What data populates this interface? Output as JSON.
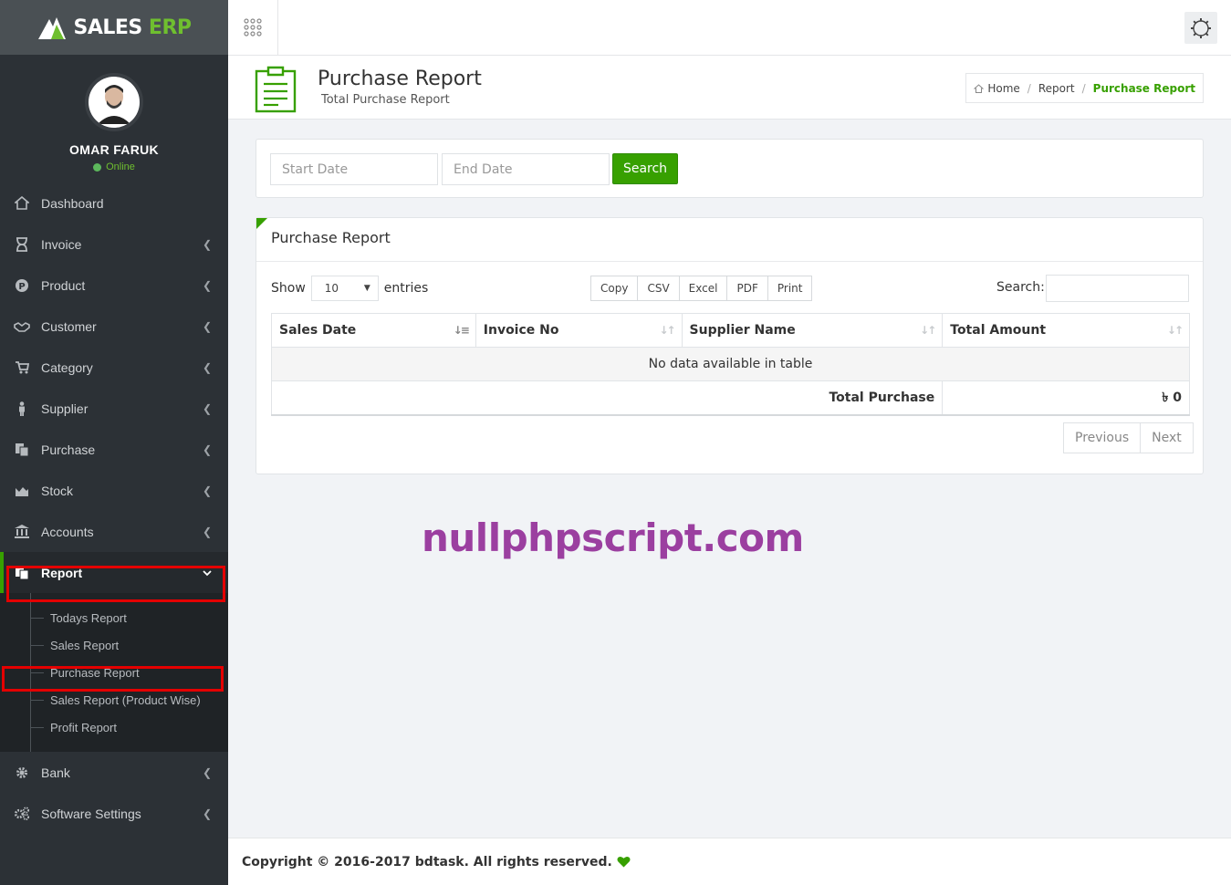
{
  "brand": {
    "name_left": "SALES",
    "name_right": "ERP"
  },
  "user": {
    "name": "OMAR FARUK",
    "status": "Online"
  },
  "sidebar": {
    "items": [
      {
        "label": "Dashboard",
        "icon": "home-icon"
      },
      {
        "label": "Invoice",
        "icon": "hourglass-icon"
      },
      {
        "label": "Product",
        "icon": "product-icon"
      },
      {
        "label": "Customer",
        "icon": "handshake-icon"
      },
      {
        "label": "Category",
        "icon": "cart-icon"
      },
      {
        "label": "Supplier",
        "icon": "person-icon"
      },
      {
        "label": "Purchase",
        "icon": "documents-icon"
      },
      {
        "label": "Stock",
        "icon": "chart-icon"
      },
      {
        "label": "Accounts",
        "icon": "bank-icon"
      },
      {
        "label": "Report",
        "icon": "report-icon"
      },
      {
        "label": "Bank",
        "icon": "gear-icon"
      },
      {
        "label": "Software Settings",
        "icon": "gears-icon"
      }
    ],
    "report_submenu": [
      "Todays Report",
      "Sales Report",
      "Purchase Report",
      "Sales Report (Product Wise)",
      "Profit Report"
    ]
  },
  "header": {
    "title": "Purchase Report",
    "subtitle": "Total Purchase Report",
    "breadcrumb": [
      "Home",
      "Report",
      "Purchase Report"
    ]
  },
  "search_form": {
    "start_placeholder": "Start Date",
    "end_placeholder": "End Date",
    "button": "Search"
  },
  "report": {
    "title": "Purchase Report",
    "show_label": "Show",
    "entries_value": "10",
    "entries_label": "entries",
    "export_buttons": [
      "Copy",
      "CSV",
      "Excel",
      "PDF",
      "Print"
    ],
    "search_label": "Search:",
    "columns": [
      "Sales Date",
      "Invoice No",
      "Supplier Name",
      "Total Amount"
    ],
    "empty_message": "No data available in table",
    "total_label": "Total Purchase",
    "total_value": "৳ 0",
    "pagination": {
      "previous": "Previous",
      "next": "Next"
    }
  },
  "watermark": "nullphpscript.com",
  "footer": {
    "copyright": "Copyright © 2016-2017 bdtask. All rights reserved."
  },
  "colors": {
    "accent": "#37a000",
    "sidebar": "#2c3136",
    "highlight": "#e40000",
    "watermark": "#9b3fa0"
  }
}
